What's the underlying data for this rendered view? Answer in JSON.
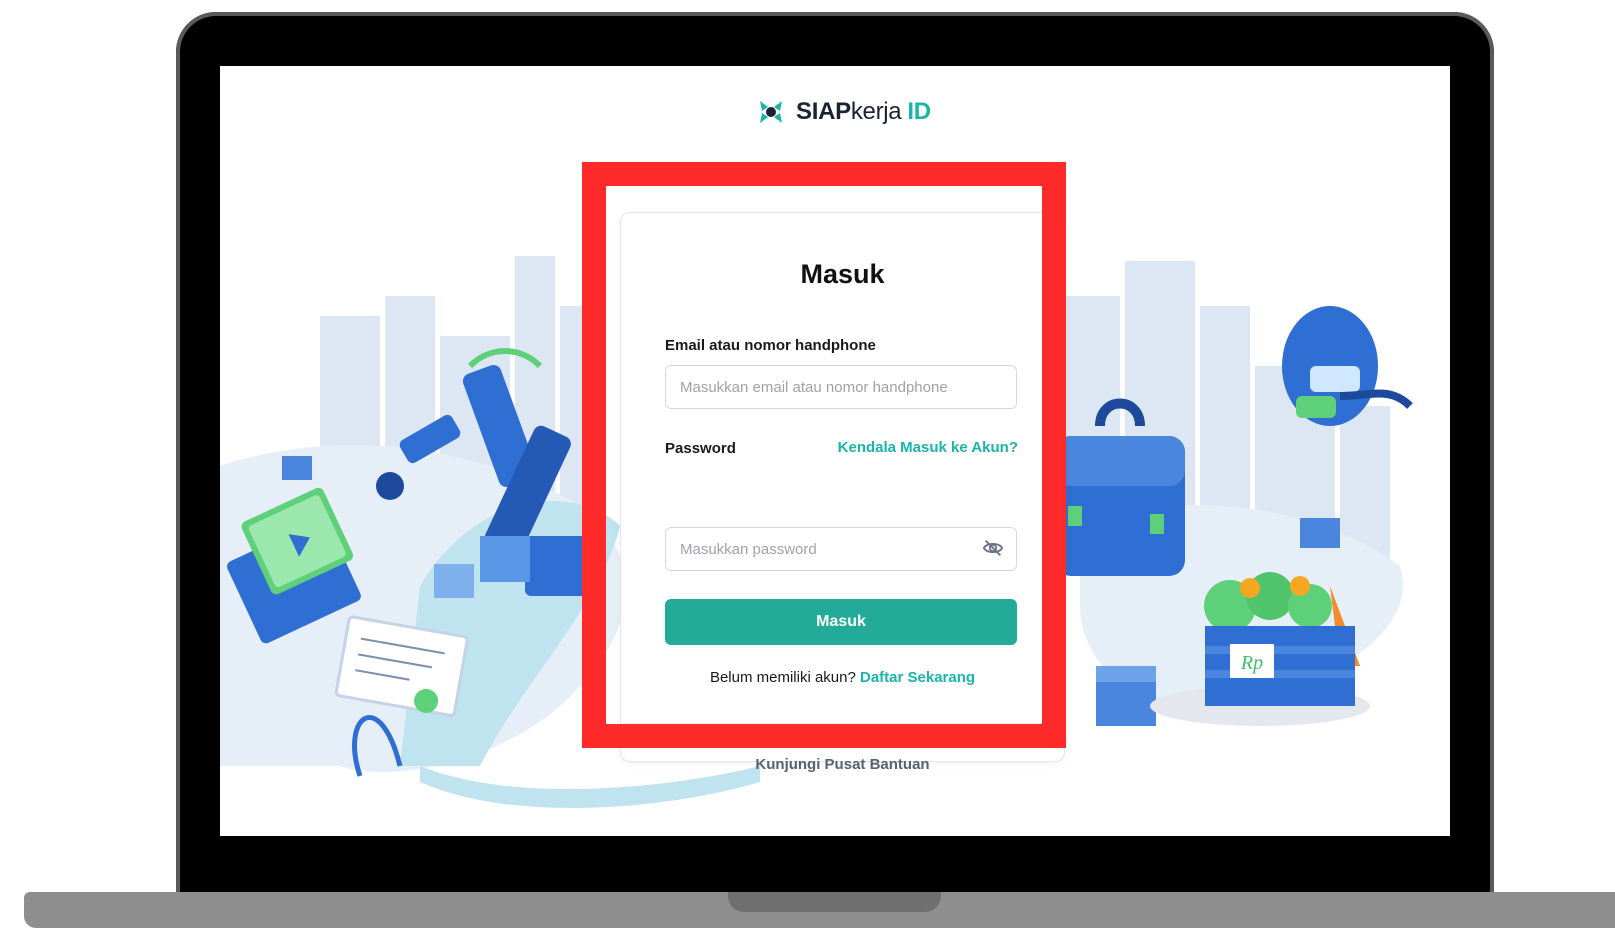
{
  "logo": {
    "brand_bold": "SIAP",
    "brand_regular": "kerja",
    "brand_id": "ID"
  },
  "login": {
    "title": "Masuk",
    "email_label": "Email atau nomor handphone",
    "email_placeholder": "Masukkan email atau nomor handphone",
    "password_label": "Password",
    "trouble_link": "Kendala Masuk ke Akun?",
    "password_placeholder": "Masukkan password",
    "submit_label": "Masuk",
    "register_prompt": "Belum memiliki akun?",
    "register_link": "Daftar Sekarang",
    "help_link": "Kunjungi Pusat Bantuan"
  },
  "illustration": {
    "price_tag": "Rp"
  },
  "colors": {
    "accent": "#19b5a9",
    "button": "#23ab99",
    "highlight": "#ff2a2a",
    "illustration_blue": "#2f6fd3",
    "illustration_green": "#5fd07a"
  }
}
